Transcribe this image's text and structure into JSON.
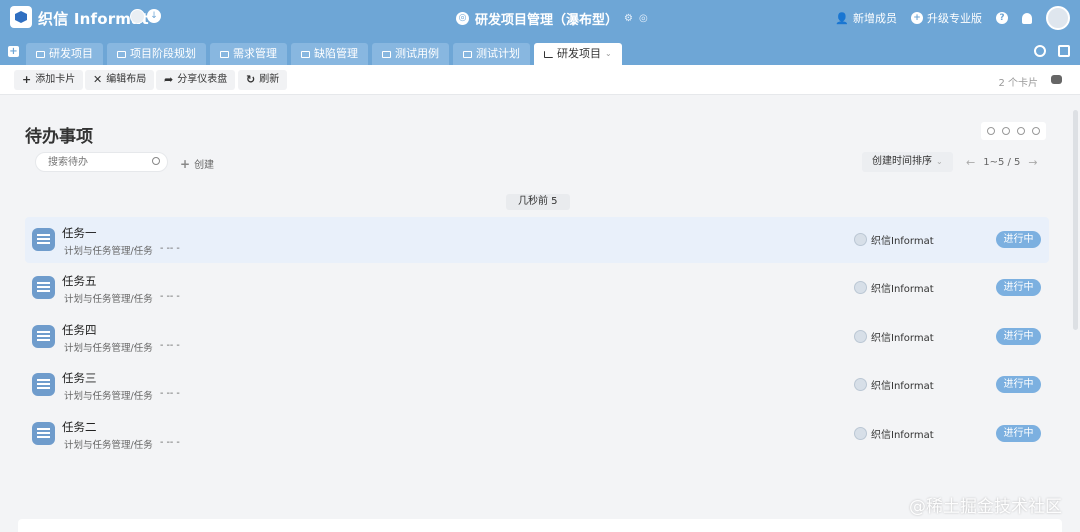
{
  "app": {
    "brand": "织信 Informat",
    "project_title": "研发项目管理（瀑布型）",
    "invite_label": "新增成员",
    "upgrade_label": "升级专业版",
    "help_label": "?"
  },
  "tabs": [
    {
      "label": "研发项目",
      "active": false
    },
    {
      "label": "项目阶段规划",
      "active": false
    },
    {
      "label": "需求管理",
      "active": false
    },
    {
      "label": "缺陷管理",
      "active": false
    },
    {
      "label": "测试用例",
      "active": false
    },
    {
      "label": "测试计划",
      "active": false
    },
    {
      "label": "研发项目",
      "active": true
    }
  ],
  "toolbar": {
    "add_card": "添加卡片",
    "edit_layout": "编辑布局",
    "share_dashboard": "分享仪表盘",
    "refresh": "刷新",
    "cards_count": "2 个卡片"
  },
  "panel": {
    "title": "待办事项",
    "search_placeholder": "搜索待办",
    "create_label": "创建",
    "sort_label": "创建时间排序",
    "pager_text": "1~5 / 5",
    "group_label": "几秒前 5"
  },
  "tasks": [
    {
      "name": "任务一",
      "path": "计划与任务管理/任务",
      "dash": "- -- -",
      "owner": "织信Informat",
      "status": "进行中"
    },
    {
      "name": "任务五",
      "path": "计划与任务管理/任务",
      "dash": "- -- -",
      "owner": "织信Informat",
      "status": "进行中"
    },
    {
      "name": "任务四",
      "path": "计划与任务管理/任务",
      "dash": "- -- -",
      "owner": "织信Informat",
      "status": "进行中"
    },
    {
      "name": "任务三",
      "path": "计划与任务管理/任务",
      "dash": "- -- -",
      "owner": "织信Informat",
      "status": "进行中"
    },
    {
      "name": "任务二",
      "path": "计划与任务管理/任务",
      "dash": "- -- -",
      "owner": "织信Informat",
      "status": "进行中"
    }
  ],
  "watermark": "@稀土掘金技术社区",
  "colors": {
    "header": "#6ea6d6",
    "status_badge": "#7cb0e0",
    "highlight_row": "#e9f0fa"
  }
}
